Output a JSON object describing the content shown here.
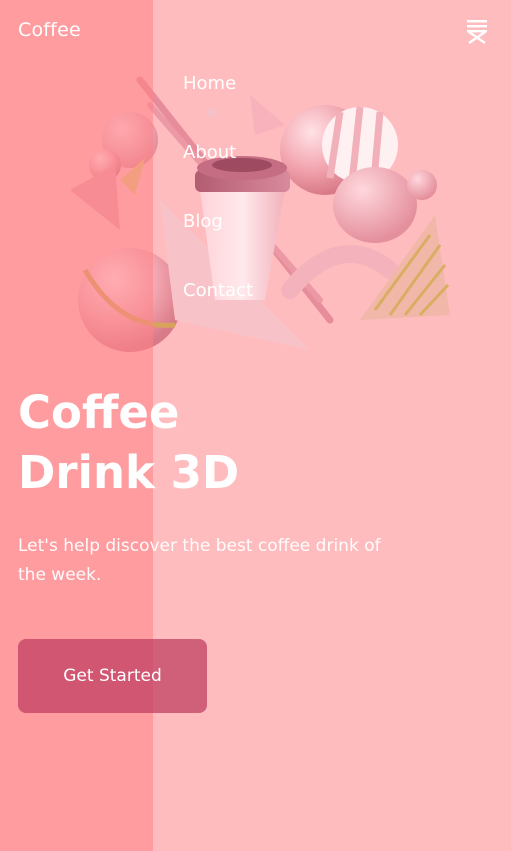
{
  "header": {
    "brand": "Coffee",
    "menu_icon": "menu-close-icon"
  },
  "nav": {
    "items": [
      {
        "label": "Home"
      },
      {
        "label": "About"
      },
      {
        "label": "Blog"
      },
      {
        "label": "Contact"
      }
    ]
  },
  "hero": {
    "title_line1": "Coffee",
    "title_line2": "Drink 3D",
    "subtitle": "Let's help discover the best coffee drink of the week.",
    "cta_label": "Get Started",
    "illustration": "3d-coffee-cup-shapes-illustration"
  },
  "colors": {
    "background": "#ffbcbe",
    "panel_overlay": "#ff8287",
    "accent": "#be3c5f",
    "text": "#ffffff"
  }
}
